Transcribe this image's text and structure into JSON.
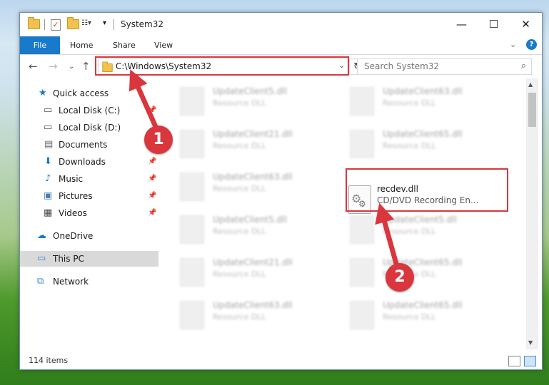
{
  "window": {
    "title": "System32",
    "controls": {
      "minimize": "—",
      "maximize": "☐",
      "close": "✕"
    }
  },
  "ribbon": {
    "tabs": [
      "File",
      "Home",
      "Share",
      "View"
    ],
    "expand_glyph": "⌄",
    "help_glyph": "?"
  },
  "navigation": {
    "back": "←",
    "forward": "→",
    "recent": "⌄",
    "up": "↑",
    "address": "C:\\Windows\\System32",
    "refresh": "↻",
    "search_placeholder": "Search System32"
  },
  "sidebar": {
    "items": [
      {
        "label": "Quick access",
        "icon": "star-icon",
        "pinned": false
      },
      {
        "label": "Local Disk (C:)",
        "icon": "drive-icon",
        "pinned": true
      },
      {
        "label": "Local Disk (D:)",
        "icon": "drive-icon",
        "pinned": false
      },
      {
        "label": "Documents",
        "icon": "documents-icon",
        "pinned": true
      },
      {
        "label": "Downloads",
        "icon": "download-icon",
        "pinned": true
      },
      {
        "label": "Music",
        "icon": "music-icon",
        "pinned": true
      },
      {
        "label": "Pictures",
        "icon": "pictures-icon",
        "pinned": true
      },
      {
        "label": "Videos",
        "icon": "video-icon",
        "pinned": true
      },
      {
        "label": "OneDrive",
        "icon": "cloud-icon",
        "pinned": false
      },
      {
        "label": "This PC",
        "icon": "computer-icon",
        "pinned": false,
        "selected": true
      },
      {
        "label": "Network",
        "icon": "network-icon",
        "pinned": false
      }
    ]
  },
  "files": {
    "highlighted": {
      "name": "recdev.dll",
      "type": "CD/DVD Recording En..."
    },
    "blurred": [
      {
        "name": "UpdateClient5.dll",
        "type": "Resource DLL"
      },
      {
        "name": "UpdateClient63.dll",
        "type": "Resource DLL"
      },
      {
        "name": "UpdateClient21.dll",
        "type": "Resource DLL"
      },
      {
        "name": "UpdateClient65.dll",
        "type": "Resource DLL"
      },
      {
        "name": "UpdateClient63.dll",
        "type": "Resource DLL"
      },
      {
        "name": "UpdateClient5.dll",
        "type": "Resource DLL"
      },
      {
        "name": "UpdateClient5.dll",
        "type": "Resource DLL"
      },
      {
        "name": "UpdateClient21.dll",
        "type": "Resource DLL"
      },
      {
        "name": "UpdateClient65.dll",
        "type": "Resource DLL"
      },
      {
        "name": "UpdateClient63.dll",
        "type": "Resource DLL"
      },
      {
        "name": "UpdateClient65.dll",
        "type": "Resource DLL"
      }
    ]
  },
  "status_bar": {
    "item_count": "114 items"
  },
  "annotations": {
    "step1": "1",
    "step2": "2",
    "color": "#d9363e"
  }
}
